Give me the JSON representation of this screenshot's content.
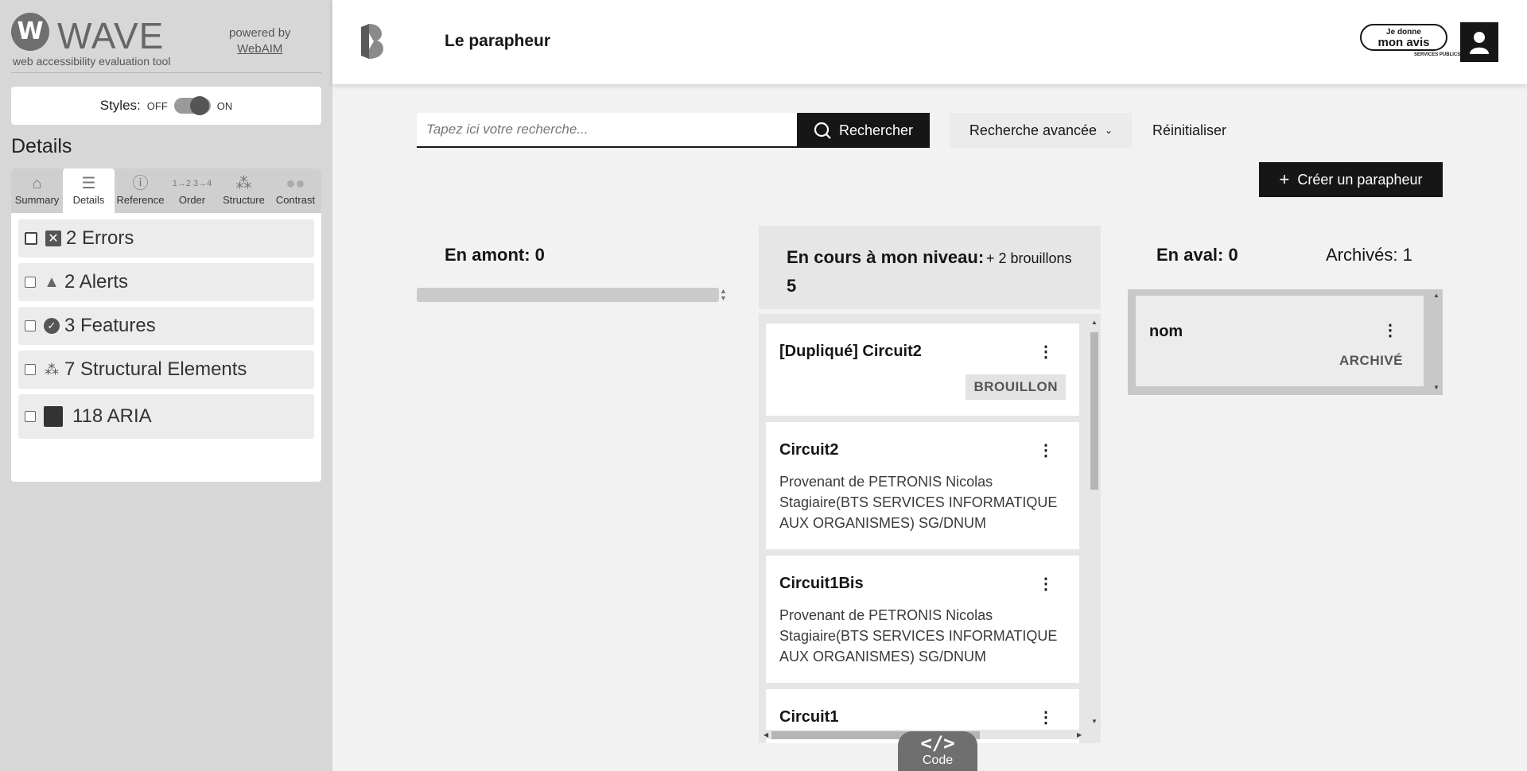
{
  "wave": {
    "brand": "WAVE",
    "subtitle": "web accessibility evaluation tool",
    "powered_by": "powered by",
    "webaim_link": "WebAIM",
    "styles_label": "Styles:",
    "styles_off": "OFF",
    "styles_on": "ON",
    "details_heading": "Details",
    "tabs": [
      {
        "label": "Summary",
        "icon": "home-icon"
      },
      {
        "label": "Details",
        "icon": "list-icon"
      },
      {
        "label": "Reference",
        "icon": "info-icon"
      },
      {
        "label": "Order",
        "icon": "order-icon"
      },
      {
        "label": "Structure",
        "icon": "structure-icon"
      },
      {
        "label": "Contrast",
        "icon": "contrast-icon"
      }
    ],
    "active_tab": "Details",
    "categories": [
      {
        "label": "2 Errors",
        "icon": "error-icon"
      },
      {
        "label": "2 Alerts",
        "icon": "alert-icon"
      },
      {
        "label": "3 Features",
        "icon": "feature-icon"
      },
      {
        "label": "7 Structural Elements",
        "icon": "structure-icon"
      },
      {
        "label": "118 ARIA",
        "icon": "aria-icon"
      }
    ]
  },
  "header": {
    "app_title": "Le parapheur",
    "avis_line1": "Je donne",
    "avis_line2": "mon avis",
    "avis_small": "SERVICES PUBLICS+"
  },
  "search": {
    "placeholder": "Tapez ici votre recherche...",
    "button": "Rechercher",
    "advanced": "Recherche avancée",
    "reset": "Réinitialiser",
    "create": "Créer un parapheur"
  },
  "columns": {
    "amont": "En amont: 0",
    "cours_title": "En cours à mon niveau: 5",
    "cours_drafts": "+ 2 brouillons",
    "aval": "En aval: 0",
    "archives": "Archivés: 1"
  },
  "cards": [
    {
      "title": "[Dupliqué] Circuit2",
      "badge": "BROUILLON",
      "desc": ""
    },
    {
      "title": "Circuit2",
      "badge": "",
      "desc": "Provenant de PETRONIS Nicolas Stagiaire(BTS SERVICES INFORMATIQUE AUX ORGANISMES) SG/DNUM"
    },
    {
      "title": "Circuit1Bis",
      "badge": "",
      "desc": "Provenant de PETRONIS Nicolas Stagiaire(BTS SERVICES INFORMATIQUE AUX ORGANISMES) SG/DNUM"
    },
    {
      "title": "Circuit1",
      "badge": "",
      "desc": ""
    }
  ],
  "archived_card": {
    "title": "nom",
    "badge": "ARCHIVÉ"
  },
  "code_tab": {
    "symbol": "</>",
    "label": "Code"
  },
  "colors": {
    "primary": "#161616",
    "wave_bg": "#d7d7d7",
    "page_bg": "#f2f2f2"
  }
}
